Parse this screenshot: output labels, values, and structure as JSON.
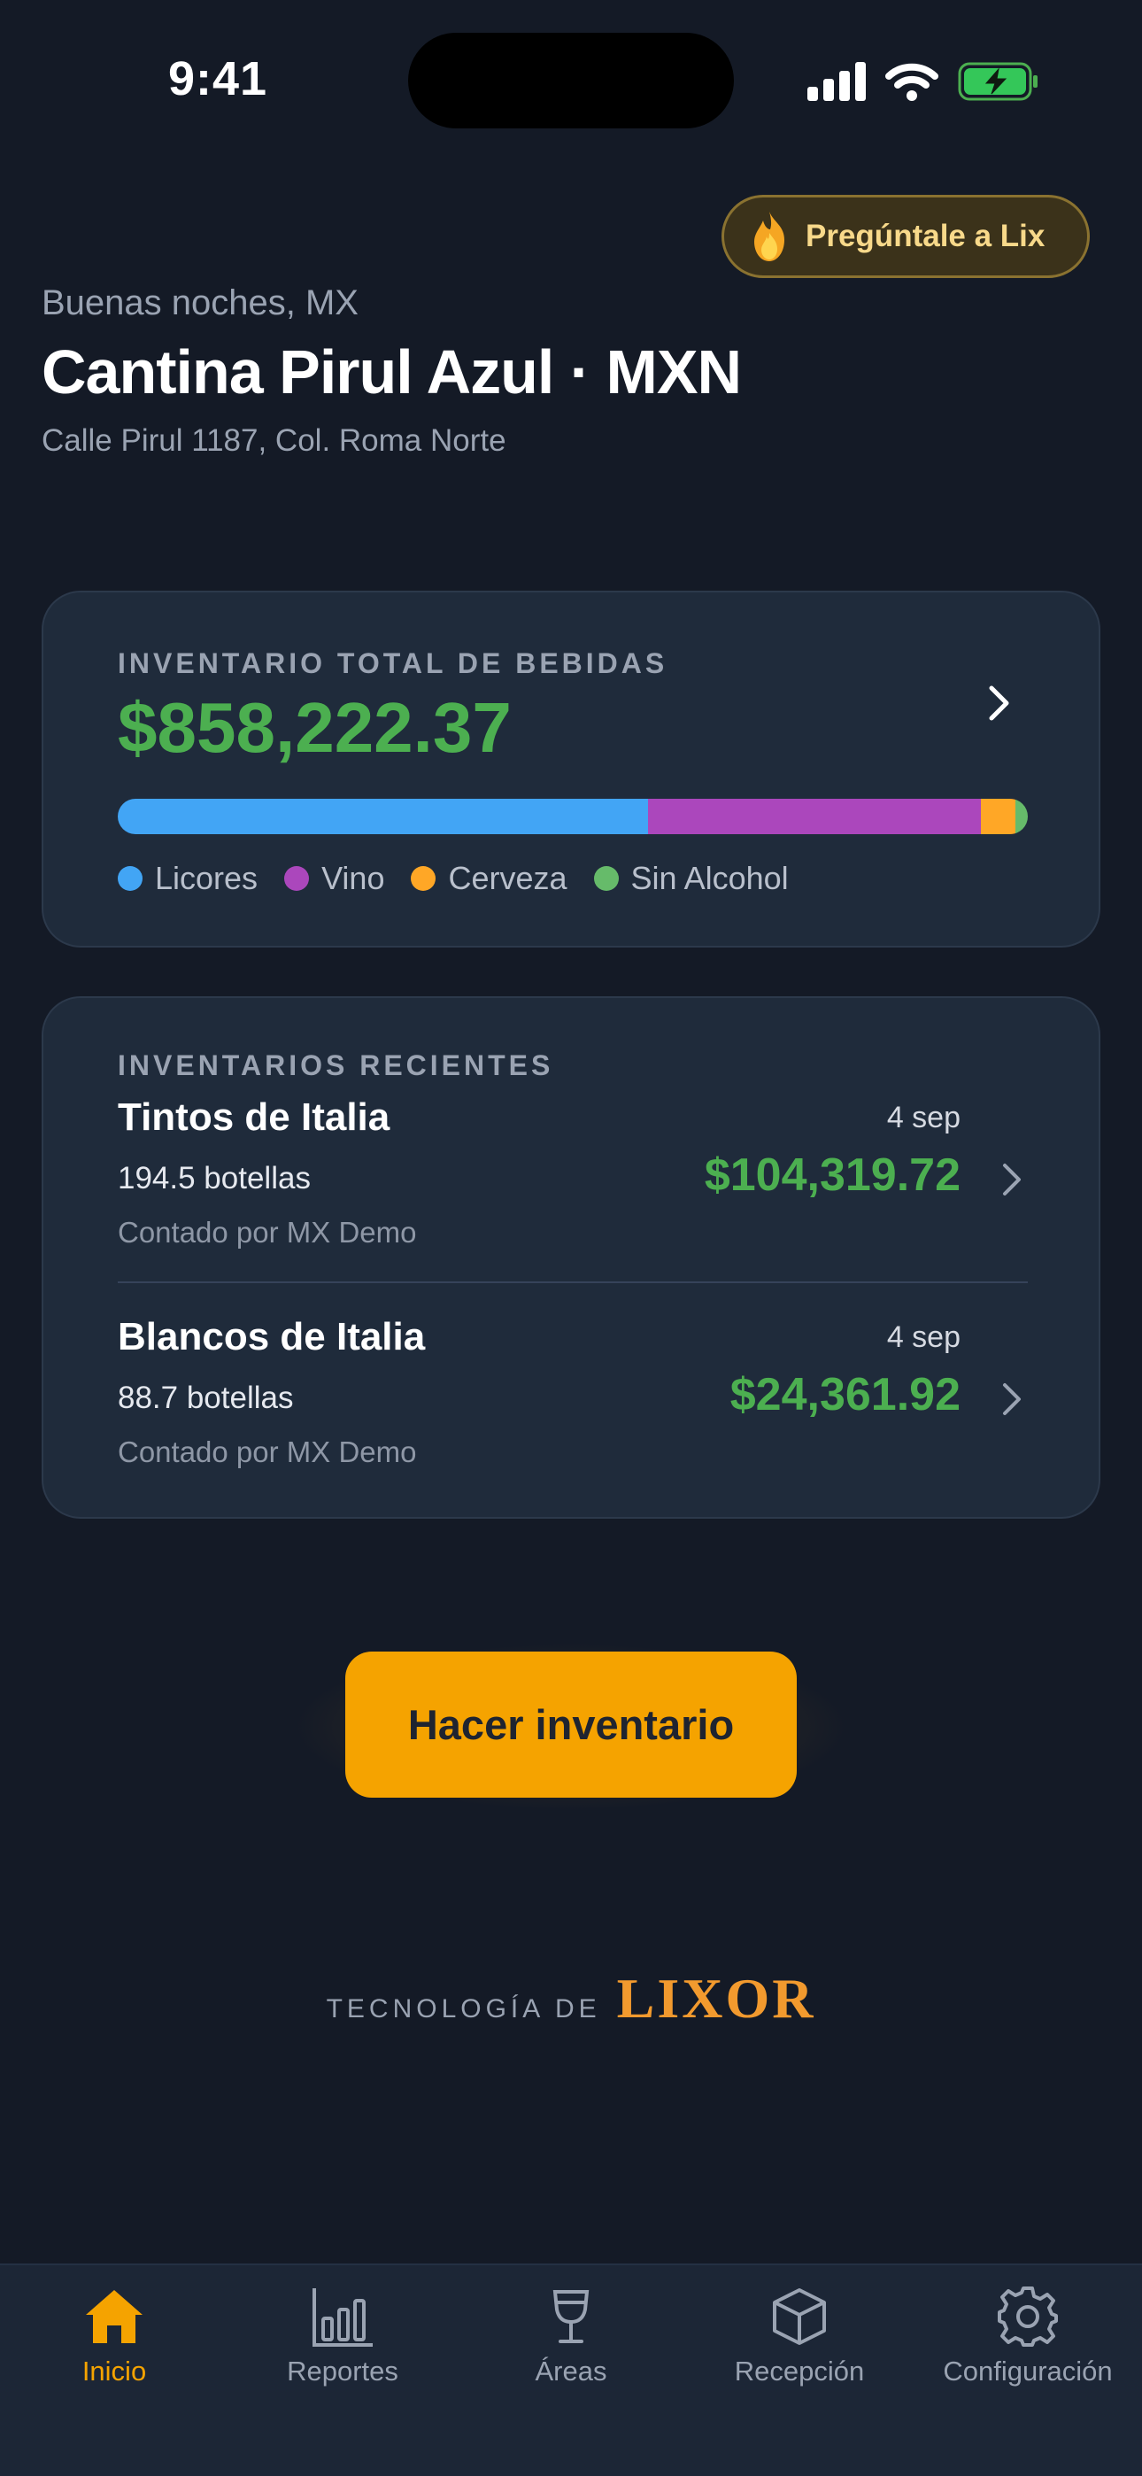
{
  "status_bar": {
    "time": "9:41"
  },
  "header": {
    "ask_button_label": "Pregúntale a Lix",
    "greeting": "Buenas noches, MX",
    "venue": "Cantina Pirul Azul · MXN",
    "address": "Calle Pirul 1187, Col. Roma Norte"
  },
  "total_card": {
    "eyebrow": "INVENTARIO TOTAL DE BEBIDAS",
    "value": "$858,222.37",
    "breakdown": [
      {
        "label": "Licores",
        "color": "#42a5f5",
        "share": 0.583
      },
      {
        "label": "Vino",
        "color": "#ab47bc",
        "share": 0.365
      },
      {
        "label": "Cerveza",
        "color": "#ffa726",
        "share": 0.038
      },
      {
        "label": "Sin Alcohol",
        "color": "#66bb6a",
        "share": 0.014
      }
    ]
  },
  "recent_card": {
    "eyebrow": "INVENTARIOS RECIENTES",
    "items": [
      {
        "name": "Tintos de Italia",
        "date": "4 sep",
        "quantity": "194.5 botellas",
        "amount": "$104,319.72",
        "counted_by": "Contado por MX Demo"
      },
      {
        "name": "Blancos de Italia",
        "date": "4 sep",
        "quantity": "88.7 botellas",
        "amount": "$24,361.92",
        "counted_by": "Contado por MX Demo"
      }
    ]
  },
  "cta": {
    "label": "Hacer inventario"
  },
  "footer": {
    "powered_by": "TECNOLOGÍA DE",
    "brand": "LIXOR"
  },
  "tabs": [
    {
      "label": "Inicio",
      "icon": "home-icon",
      "active": true
    },
    {
      "label": "Reportes",
      "icon": "bar-chart-icon",
      "active": false
    },
    {
      "label": "Áreas",
      "icon": "wine-glass-icon",
      "active": false
    },
    {
      "label": "Recepción",
      "icon": "box-icon",
      "active": false
    },
    {
      "label": "Configuración",
      "icon": "gear-icon",
      "active": false
    }
  ],
  "colors": {
    "accent": "#f5a300",
    "positive": "#4caf50",
    "background": "#141a26",
    "card": "#1f2b3b"
  }
}
